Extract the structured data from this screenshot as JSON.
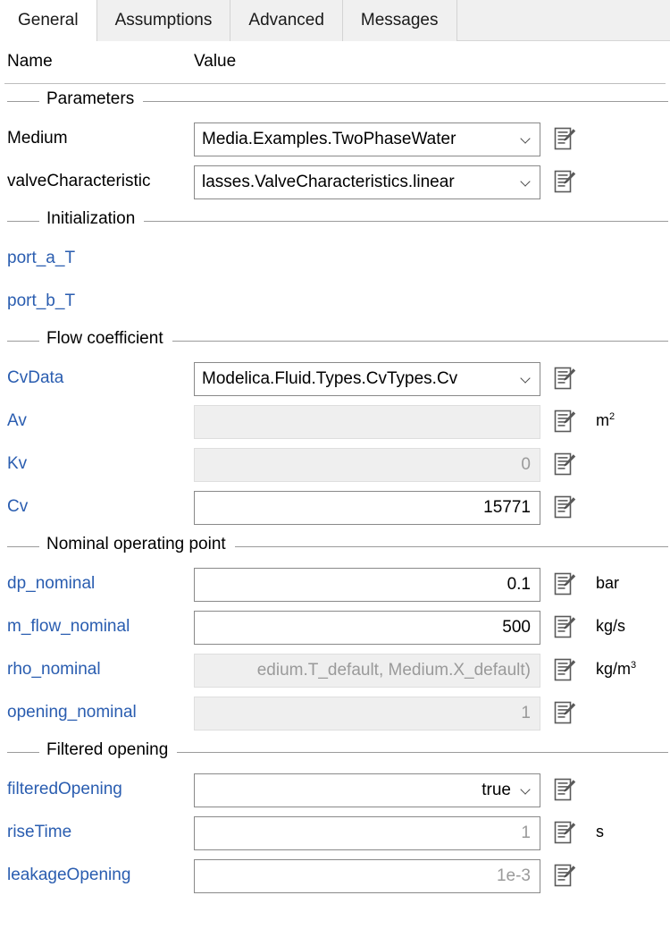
{
  "tabs": [
    {
      "label": "General",
      "active": true
    },
    {
      "label": "Assumptions",
      "active": false
    },
    {
      "label": "Advanced",
      "active": false
    },
    {
      "label": "Messages",
      "active": false
    }
  ],
  "columns": {
    "name": "Name",
    "value": "Value"
  },
  "colors": {
    "link": "#2a5db0",
    "disabled_text": "#9a9a9a",
    "field_border": "#898989",
    "disabled_bg": "#efefef",
    "tab_bar_bg": "#f0f0f0"
  },
  "icons": {
    "edit": "edit-document-icon",
    "chevron": "chevron-down-icon"
  },
  "groups": [
    {
      "title": "Parameters",
      "rows": [
        {
          "label": "Medium",
          "label_style": "plain",
          "control": "combo",
          "value": "Media.Examples.TwoPhaseWater",
          "value_style": "black",
          "align": "left",
          "disabled": false,
          "unit": "",
          "unit_sup": ""
        },
        {
          "label": "valveCharacteristic",
          "label_style": "plain",
          "control": "combo",
          "value": "lasses.ValveCharacteristics.linear",
          "value_style": "black",
          "align": "left",
          "disabled": false,
          "unit": "",
          "unit_sup": ""
        }
      ]
    },
    {
      "title": "Initialization",
      "rows": [
        {
          "label": "port_a_T",
          "label_style": "link",
          "control": "none",
          "value": "",
          "value_style": "black",
          "align": "right",
          "disabled": false,
          "unit": "",
          "unit_sup": ""
        },
        {
          "label": "port_b_T",
          "label_style": "link",
          "control": "none",
          "value": "",
          "value_style": "black",
          "align": "right",
          "disabled": false,
          "unit": "",
          "unit_sup": ""
        }
      ]
    },
    {
      "title": "Flow coefficient",
      "rows": [
        {
          "label": "CvData",
          "label_style": "link",
          "control": "combo",
          "value": "Modelica.Fluid.Types.CvTypes.Cv",
          "value_style": "black",
          "align": "left",
          "disabled": false,
          "unit": "",
          "unit_sup": ""
        },
        {
          "label": "Av",
          "label_style": "link",
          "control": "text",
          "value": "",
          "value_style": "grey",
          "align": "right",
          "disabled": true,
          "unit": "m",
          "unit_sup": "2"
        },
        {
          "label": "Kv",
          "label_style": "link",
          "control": "text",
          "value": "0",
          "value_style": "grey",
          "align": "right",
          "disabled": true,
          "unit": "",
          "unit_sup": ""
        },
        {
          "label": "Cv",
          "label_style": "link",
          "control": "text",
          "value": "15771",
          "value_style": "black",
          "align": "right",
          "disabled": false,
          "unit": "",
          "unit_sup": ""
        }
      ]
    },
    {
      "title": "Nominal operating point",
      "rows": [
        {
          "label": "dp_nominal",
          "label_style": "link",
          "control": "text",
          "value": "0.1",
          "value_style": "black",
          "align": "right",
          "disabled": false,
          "unit": "bar",
          "unit_sup": ""
        },
        {
          "label": "m_flow_nominal",
          "label_style": "link",
          "control": "text",
          "value": "500",
          "value_style": "black",
          "align": "right",
          "disabled": false,
          "unit": "kg/s",
          "unit_sup": ""
        },
        {
          "label": "rho_nominal",
          "label_style": "link",
          "control": "text",
          "value": "edium.T_default, Medium.X_default)",
          "value_style": "grey",
          "align": "right",
          "disabled": true,
          "unit": "kg/m",
          "unit_sup": "3"
        },
        {
          "label": "opening_nominal",
          "label_style": "link",
          "control": "text",
          "value": "1",
          "value_style": "grey",
          "align": "right",
          "disabled": true,
          "unit": "",
          "unit_sup": ""
        }
      ]
    },
    {
      "title": "Filtered opening",
      "rows": [
        {
          "label": "filteredOpening",
          "label_style": "link",
          "control": "combo",
          "value": "true",
          "value_style": "black",
          "align": "right",
          "disabled": false,
          "unit": "",
          "unit_sup": ""
        },
        {
          "label": "riseTime",
          "label_style": "link",
          "control": "text",
          "value": "1",
          "value_style": "grey",
          "align": "right",
          "disabled": false,
          "unit": "s",
          "unit_sup": ""
        },
        {
          "label": "leakageOpening",
          "label_style": "link",
          "control": "text",
          "value": "1e-3",
          "value_style": "grey",
          "align": "right",
          "disabled": false,
          "unit": "",
          "unit_sup": ""
        }
      ]
    }
  ]
}
